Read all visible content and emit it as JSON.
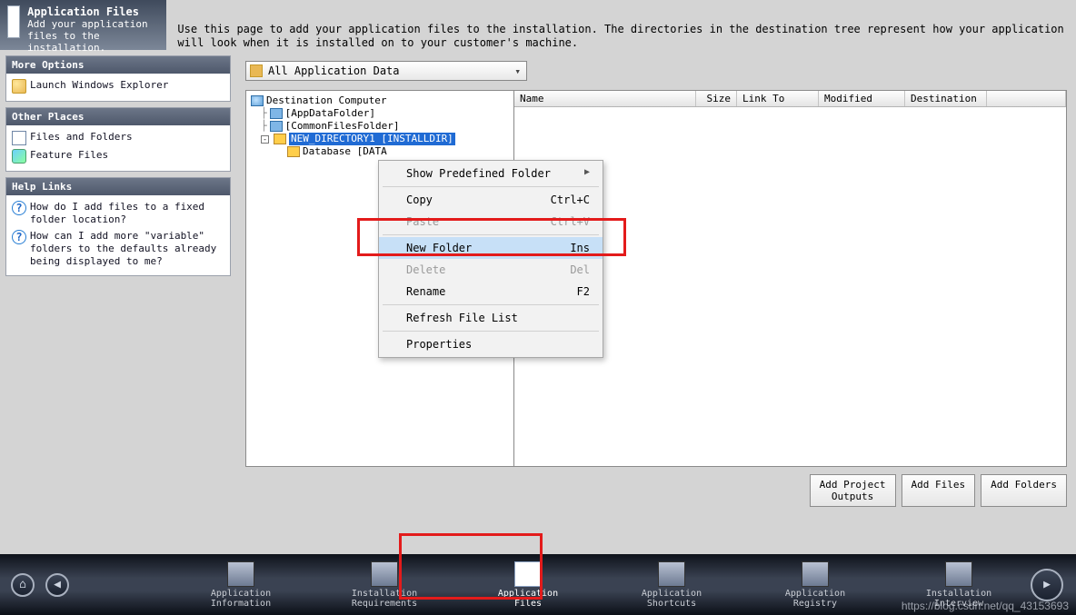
{
  "header": {
    "title": "Application Files",
    "subtitle": "Add your application files to the installation."
  },
  "description": "Use this page to add your application files to the installation. The directories in the destination tree represent how your application will look when it is installed on to your customer's machine.",
  "panels": {
    "more": {
      "title": "More Options",
      "items": [
        {
          "icon": "folder",
          "label": "Launch Windows Explorer"
        }
      ]
    },
    "other": {
      "title": "Other Places",
      "items": [
        {
          "icon": "file",
          "label": "Files and Folders"
        },
        {
          "icon": "feat",
          "label": "Feature Files"
        }
      ]
    },
    "help": {
      "title": "Help Links",
      "items": [
        {
          "icon": "help",
          "label": "How do I add files to a fixed folder location?"
        },
        {
          "icon": "help",
          "label": "How can I add more \"variable\" folders to the defaults already being displayed to me?"
        }
      ]
    }
  },
  "dropdown": {
    "value": "All Application Data"
  },
  "tree": {
    "root": "Destination Computer",
    "n1": "[AppDataFolder]",
    "n2": "[CommonFilesFolder]",
    "n3": "NEW_DIRECTORY1 [INSTALLDIR]",
    "n4": "Database [DATA"
  },
  "grid": {
    "cols": [
      "Name",
      "Size",
      "Link To",
      "Modified",
      "Destination"
    ]
  },
  "context": {
    "show_predefined": "Show Predefined Folder",
    "copy": "Copy",
    "copy_k": "Ctrl+C",
    "paste": "Paste",
    "paste_k": "Ctrl+V",
    "new_folder": "New Folder",
    "new_folder_k": "Ins",
    "delete": "Delete",
    "delete_k": "Del",
    "rename": "Rename",
    "rename_k": "F2",
    "refresh": "Refresh File List",
    "properties": "Properties"
  },
  "buttons": {
    "add_outputs": "Add Project\nOutputs",
    "add_files": "Add Files",
    "add_folders": "Add Folders"
  },
  "nav": {
    "items": [
      {
        "label": "Application\nInformation"
      },
      {
        "label": "Installation\nRequirements"
      },
      {
        "label": "Application\nFiles"
      },
      {
        "label": "Application\nShortcuts"
      },
      {
        "label": "Application\nRegistry"
      },
      {
        "label": "Installation\nInterview"
      }
    ]
  },
  "watermark": "https://blog.csdn.net/qq_43153693"
}
